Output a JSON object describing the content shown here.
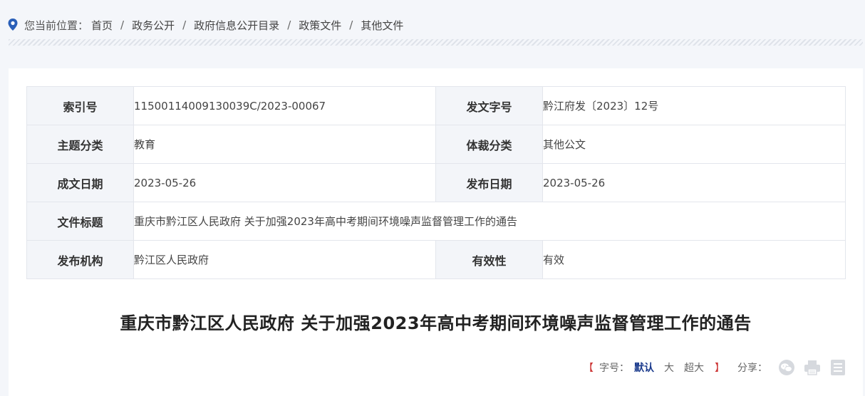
{
  "breadcrumb": {
    "prefix": "您当前位置：",
    "items": [
      "首页",
      "政务公开",
      "政府信息公开目录",
      "政策文件",
      "其他文件"
    ],
    "separator": "/"
  },
  "meta": {
    "index_label": "索引号",
    "index_value": "11500114009130039C/2023-00067",
    "doc_no_label": "发文字号",
    "doc_no_value": "黔江府发〔2023〕12号",
    "topic_label": "主题分类",
    "topic_value": "教育",
    "genre_label": "体裁分类",
    "genre_value": "其他公文",
    "date_written_label": "成文日期",
    "date_written_value": "2023-05-26",
    "date_published_label": "发布日期",
    "date_published_value": "2023-05-26",
    "title_label": "文件标题",
    "title_value": "重庆市黔江区人民政府 关于加强2023年高中考期间环境噪声监督管理工作的通告",
    "issuer_label": "发布机构",
    "issuer_value": "黔江区人民政府",
    "validity_label": "有效性",
    "validity_value": "有效"
  },
  "document": {
    "title": "重庆市黔江区人民政府 关于加强2023年高中考期间环境噪声监督管理工作的通告"
  },
  "tools": {
    "bracket_open": "【",
    "font_size_label": "字号：",
    "font_default": "默认",
    "font_large": "大",
    "font_xlarge": "超大",
    "bracket_close": "】",
    "share_label": "分享：",
    "icons": [
      "wechat-icon",
      "print-icon",
      "document-icon"
    ]
  },
  "colors": {
    "accent_blue": "#1a3a8c",
    "bracket_red": "#cc3333",
    "label_bg": "#f3f5f9",
    "border": "#e3e6ec"
  }
}
